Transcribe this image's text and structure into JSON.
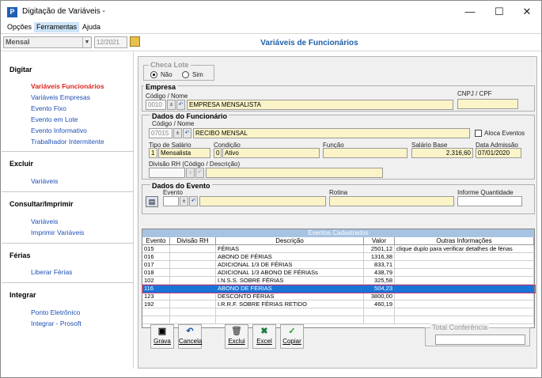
{
  "window": {
    "title": "Digitação de Variáveis -",
    "app_icon": "P",
    "controls": {
      "minimize": "—",
      "maximize": "☐",
      "close": "✕"
    }
  },
  "menubar": {
    "items": [
      "Opções",
      "Ferramentas",
      "Ajuda"
    ]
  },
  "toolbar": {
    "period_type": "Mensal",
    "period_date": "12/2021",
    "page_title": "Variáveis de Funcionários"
  },
  "sidebar": {
    "sections": [
      {
        "title": "Digitar",
        "items": [
          "Variáveis Funcionários",
          "Variáveis Empresas",
          "Evento Fixo",
          "Evento em Lote",
          "Evento Informativo",
          "Trabalhador Intermitente"
        ]
      },
      {
        "title": "Excluir",
        "items": [
          "Variáveis"
        ]
      },
      {
        "title": "Consultar/Imprimir",
        "items": [
          "Variáveis",
          "Imprimir Variáveis"
        ]
      },
      {
        "title": "Férias",
        "items": [
          "Liberar Férias"
        ]
      },
      {
        "title": "Integrar",
        "items": [
          "Ponto Eletrônico",
          "Integrar - Prosoft"
        ]
      }
    ],
    "current_item": "Variáveis Funcionários"
  },
  "checa_lote": {
    "legend": "Checa Lote",
    "options": [
      "Não",
      "Sim"
    ],
    "selected": "Não"
  },
  "empresa": {
    "legend": "Empresa",
    "codigo_label": "Código / Nome",
    "codigo": "0010",
    "nome": "EMPRESA MENSALISTA",
    "cnpj_label": "CNPJ / CPF",
    "cnpj": ""
  },
  "funcionario": {
    "legend": "Dados do Funcionário",
    "codigo_label": "Código / Nome",
    "codigo": "07015",
    "nome": "RECIBO MENSAL",
    "aloca_label": "Aloca Eventos",
    "tipo_salario_label": "Tipo de Salário",
    "tipo_salario_code": "1",
    "tipo_salario": "Mensalista",
    "condicao_label": "Condição",
    "condicao_code": "0",
    "condicao": "Ativo",
    "funcao_label": "Função",
    "funcao": "",
    "salario_base_label": "Salário Base",
    "salario_base": "2.316,60",
    "data_admissao_label": "Data Admissão",
    "data_admissao": "07/01/2020",
    "divisao_label": "Divisão RH (Código / Descrição)"
  },
  "evento": {
    "legend": "Dados do Evento",
    "evento_label": "Evento",
    "rotina_label": "Rotina",
    "informe_label": "Informe Quantidade"
  },
  "grid": {
    "title": "Eventos Cadastrados",
    "columns": [
      "Evento",
      "Divisão RH",
      "Descrição",
      "Valor",
      "Outras Informações"
    ],
    "rows": [
      {
        "evento": "015",
        "divisao": "",
        "descricao": "FÉRIAS",
        "valor": "2501,12",
        "info": "clique duplo para verificar detalhes de férias"
      },
      {
        "evento": "016",
        "divisao": "",
        "descricao": "ABONO DE FÉRIAS",
        "valor": "1316,38",
        "info": ""
      },
      {
        "evento": "017",
        "divisao": "",
        "descricao": "ADICIONAL 1/3 DE FÉRIAS",
        "valor": "833,71",
        "info": ""
      },
      {
        "evento": "018",
        "divisao": "",
        "descricao": "ADICIONAL 1/3 ABONO DE FÉRIASs",
        "valor": "438,79",
        "info": ""
      },
      {
        "evento": "102",
        "divisao": "",
        "descricao": "I.N.S.S. SOBRE FÉRIAS",
        "valor": "325,58",
        "info": ""
      },
      {
        "evento": "116",
        "divisao": "",
        "descricao": "ABONO DE FÉRIAS",
        "valor": "504,23",
        "info": ""
      },
      {
        "evento": "123",
        "divisao": "",
        "descricao": "DESCONTO FÉRIAS",
        "valor": "3800,00",
        "info": ""
      },
      {
        "evento": "192",
        "divisao": "",
        "descricao": "I.R.R.F. SOBRE FÉRIAS RETIDO",
        "valor": "460,19",
        "info": ""
      }
    ],
    "selected_evento": "116"
  },
  "buttons": {
    "grava": "Grava",
    "cancela": "Cancela",
    "exclui": "Exclui",
    "excel": "Excel",
    "copiar": "Copiar"
  },
  "total": {
    "label": "Total Conferência",
    "value": ""
  },
  "colors": {
    "link": "#1f4fb4",
    "current_link": "#e0221b",
    "title": "#1f5fa8",
    "field_bg": "#fbf4c8",
    "selection": "#1874d6",
    "grid_header": "#a7c3e1"
  }
}
